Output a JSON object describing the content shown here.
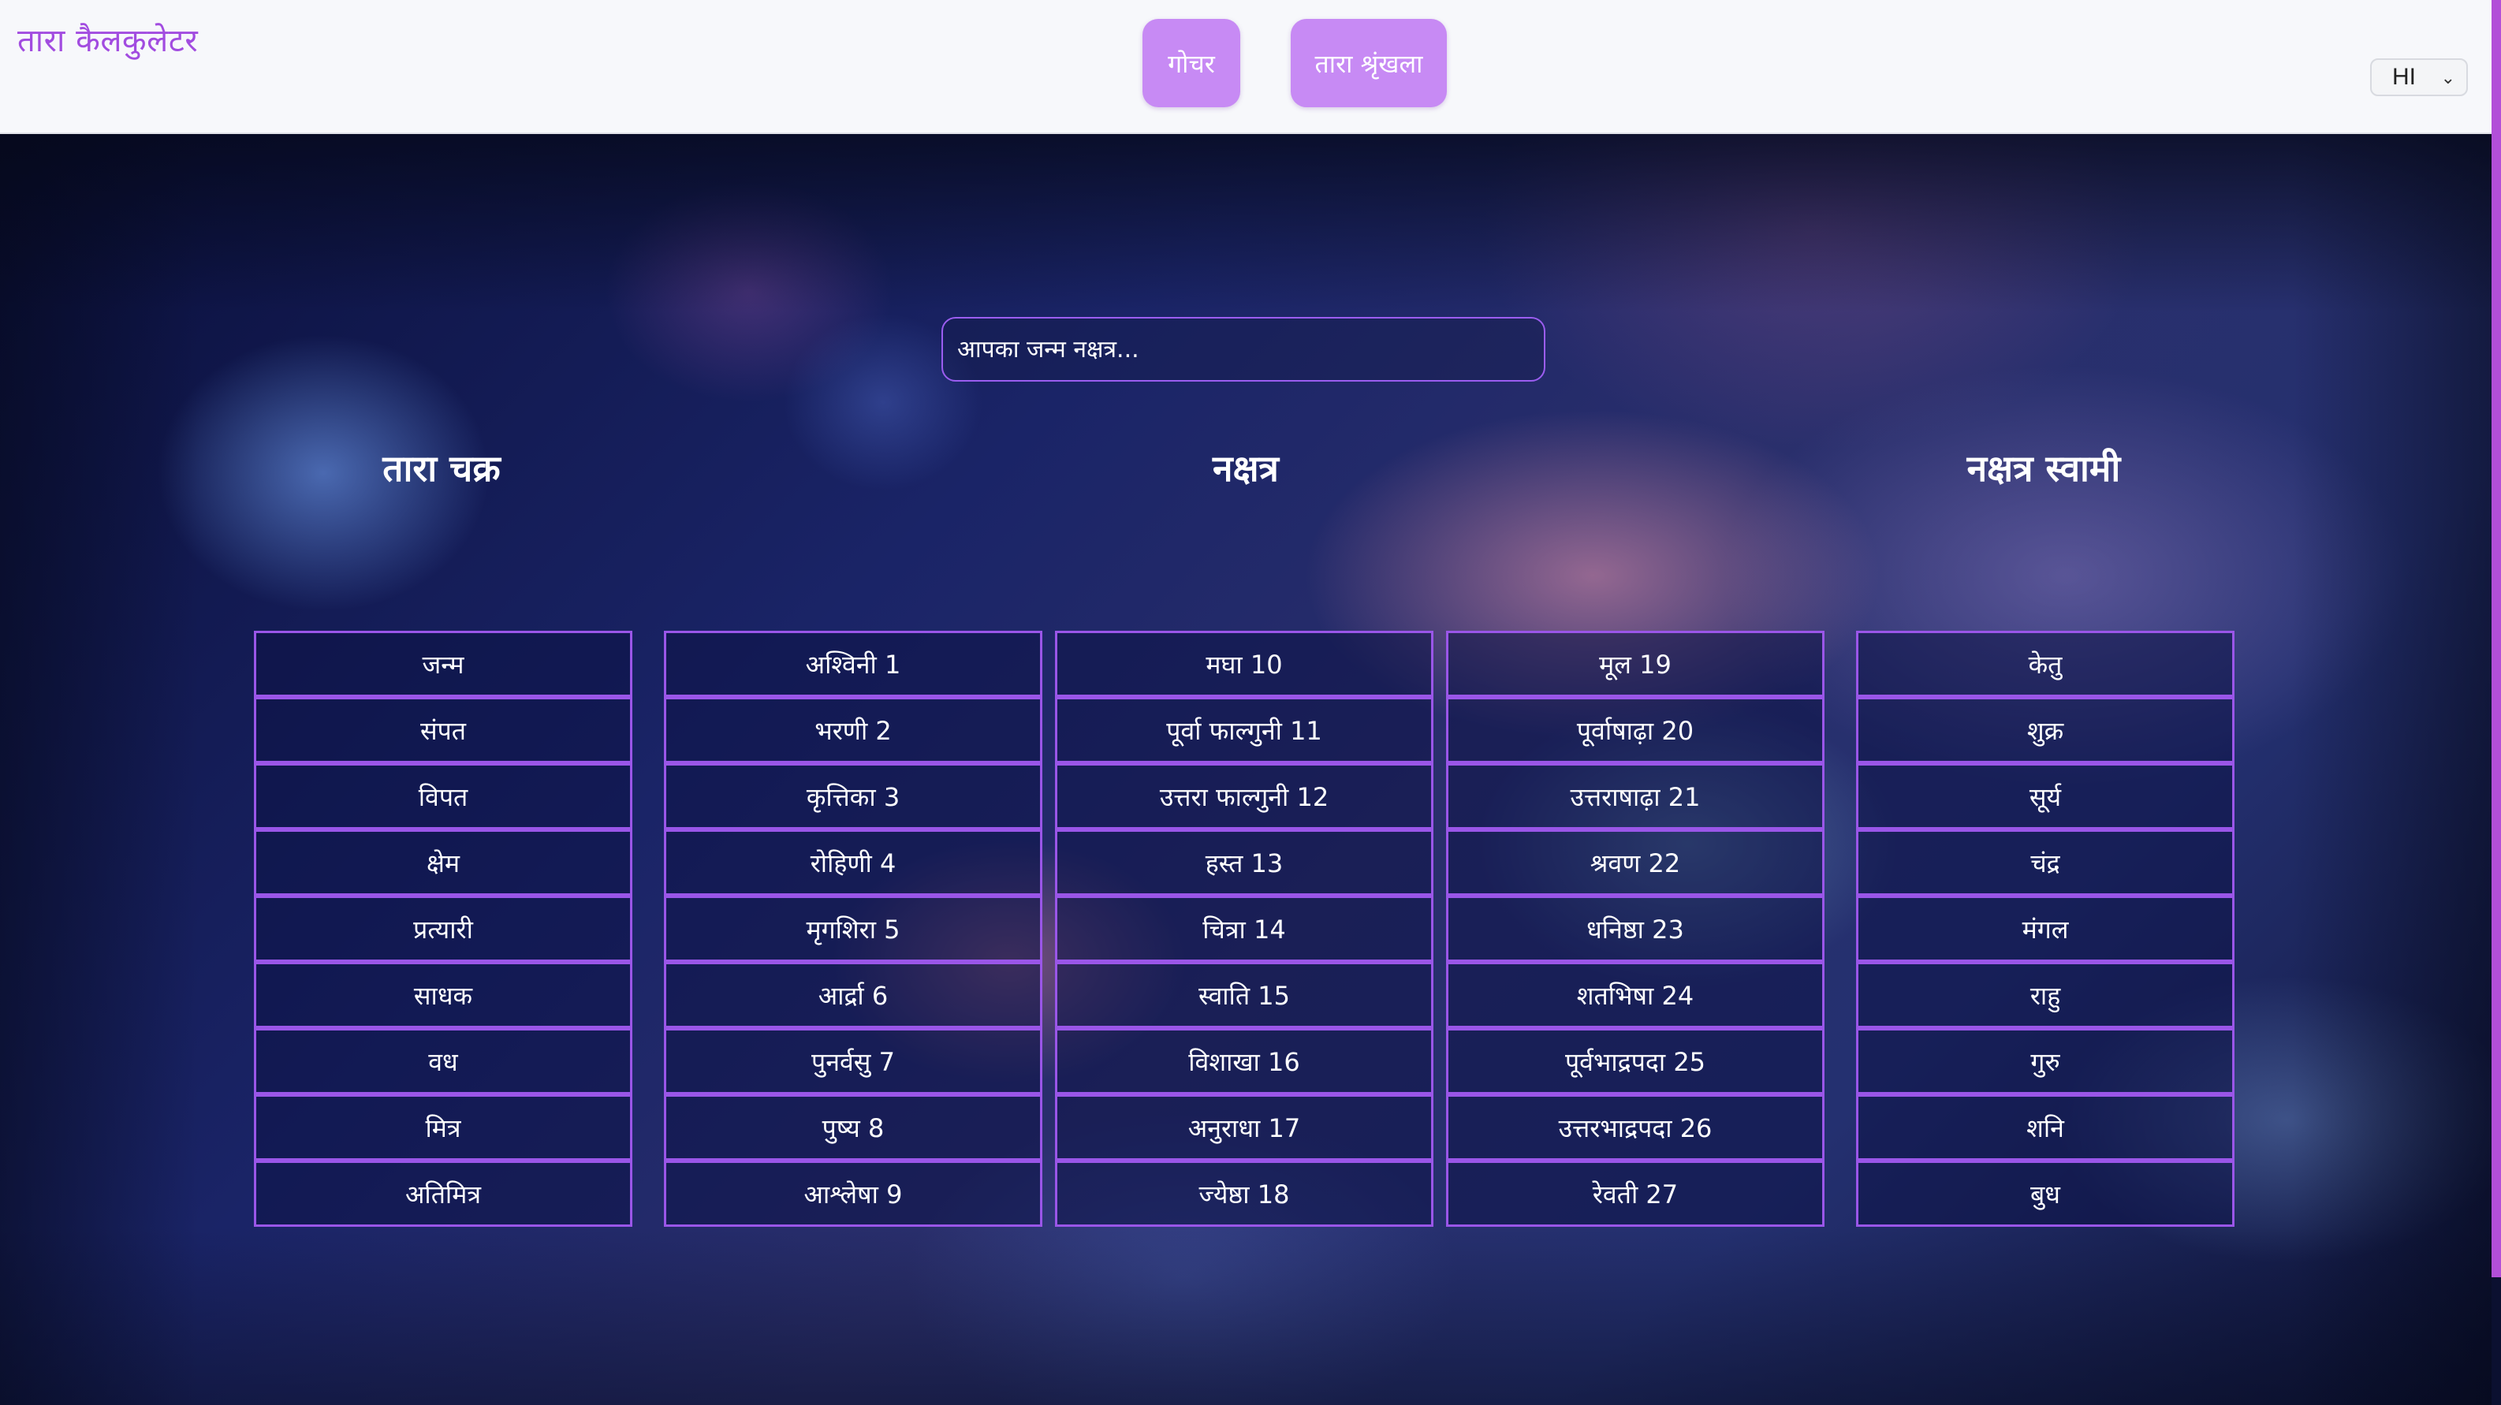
{
  "header": {
    "brand": "तारा कैलकुलेटर",
    "nav": {
      "gochar": "गोचर",
      "tara_shrinkhala": "तारा श्रृंखला"
    },
    "language": {
      "selected": "HI"
    }
  },
  "search": {
    "placeholder": "आपका जन्म नक्षत्र..."
  },
  "titles": {
    "tara_chakra": "तारा चक्र",
    "nakshatra": "नक्षत्र",
    "nakshatra_swami": "नक्षत्र स्वामी"
  },
  "tara_chakra": [
    "जन्म",
    "संपत",
    "विपत",
    "क्षेम",
    "प्रत्यारी",
    "साधक",
    "वध",
    "मित्र",
    "अतिमित्र"
  ],
  "nakshatra": {
    "col1": [
      "अश्विनी 1",
      "भरणी 2",
      "कृत्तिका 3",
      "रोहिणी 4",
      "मृगशिरा 5",
      "आर्द्रा 6",
      "पुनर्वसु 7",
      "पुष्य 8",
      "आश्लेषा 9"
    ],
    "col2": [
      "मघा 10",
      "पूर्वा फाल्गुनी 11",
      "उत्तरा फाल्गुनी 12",
      "हस्त 13",
      "चित्रा 14",
      "स्वाति 15",
      "विशाखा 16",
      "अनुराधा 17",
      "ज्येष्ठा 18"
    ],
    "col3": [
      "मूल 19",
      "पूर्वाषाढ़ा 20",
      "उत्तराषाढ़ा 21",
      "श्रवण 22",
      "धनिष्ठा 23",
      "शतभिषा 24",
      "पूर्वभाद्रपदा 25",
      "उत्तरभाद्रपदा 26",
      "रेवती 27"
    ]
  },
  "nakshatra_swami": [
    "केतु",
    "शुक्र",
    "सूर्य",
    "चंद्र",
    "मंगल",
    "राहु",
    "गुरु",
    "शनि",
    "बुध"
  ],
  "colors": {
    "accent": "#c78af4",
    "brand": "#a24ce0",
    "cell_border": "#9a56e8"
  }
}
